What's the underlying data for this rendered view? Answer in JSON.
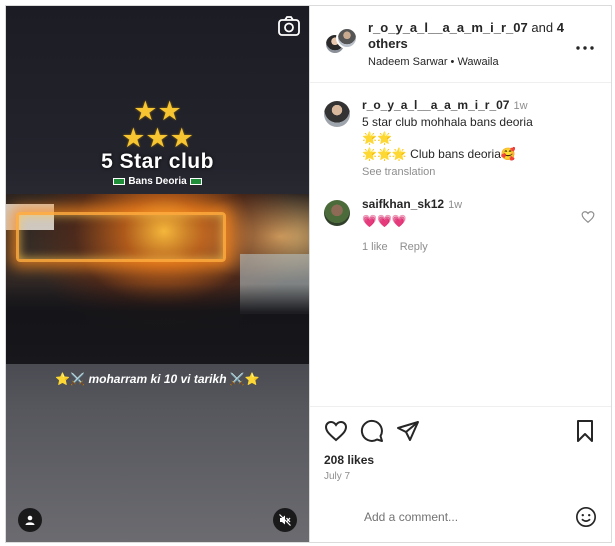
{
  "media": {
    "stars": "★★",
    "stars_row2": "★★★",
    "title": "5 Star club",
    "subtitle": "Bans Deoria",
    "caption_left_star": "⭐⚔️",
    "caption_text": " moharram ki 10 vi tarikh ",
    "caption_right_star": "⚔️⭐"
  },
  "header": {
    "username": "r_o_y_a_l__a_a_m_i_r_07",
    "and_text": " and ",
    "others": "4 others",
    "subtitle": "Nadeem Sarwar • Wawaila"
  },
  "comments": [
    {
      "username": "r_o_y_a_l__a_a_m_i_r_07",
      "time": "1w",
      "line1": "5 star club mohhala bans deoria",
      "line2": "🌟🌟",
      "line3": "🌟🌟🌟 Club bans deoria🥰",
      "see_translation": "See translation"
    },
    {
      "username": "saifkhan_sk12",
      "time": "1w",
      "text": "💗💗💗",
      "likes": "1 like",
      "reply": "Reply"
    }
  ],
  "post": {
    "likes": "208 likes",
    "date": "July 7"
  },
  "comment_box": {
    "placeholder": "Add a comment..."
  }
}
